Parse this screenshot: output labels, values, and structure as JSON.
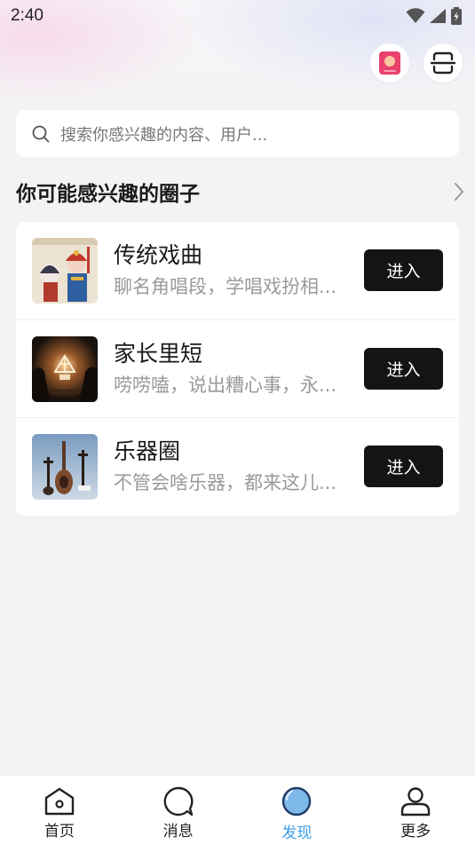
{
  "status_bar": {
    "time": "2:40"
  },
  "search": {
    "placeholder": "搜索你感兴趣的内容、用户..."
  },
  "section": {
    "title": "你可能感兴趣的圈子"
  },
  "circles": [
    {
      "title": "传统戏曲",
      "desc": " 聊名角唱段，学唱戏扮相...",
      "button": "进入",
      "thumb_icon": "peking-opera-thumbnail"
    },
    {
      "title": "家长里短",
      "desc": "唠唠嗑，说出糟心事，永...",
      "button": "进入",
      "thumb_icon": "campfire-thumbnail"
    },
    {
      "title": "乐器圈",
      "desc": "不管会啥乐器，都来这儿...",
      "button": "进入",
      "thumb_icon": "instruments-thumbnail"
    }
  ],
  "tabs": [
    {
      "label": "首页",
      "icon": "home-icon",
      "active": false
    },
    {
      "label": "消息",
      "icon": "message-icon",
      "active": false
    },
    {
      "label": "发现",
      "icon": "discover-icon",
      "active": true
    },
    {
      "label": "更多",
      "icon": "profile-icon",
      "active": false
    }
  ],
  "colors": {
    "accent": "#3d9ee8",
    "button": "#141414",
    "background": "#f3f3f5"
  }
}
